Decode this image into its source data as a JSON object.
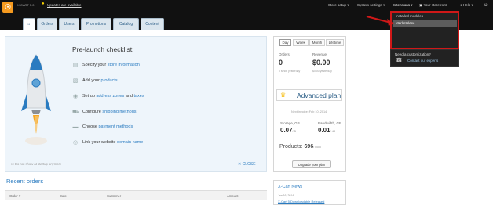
{
  "topbar": {
    "logo_letter": "☉",
    "powered": "X-CART 5.0",
    "updates": "Updates are available",
    "store_setup": "Store setup",
    "system_settings": "System settings",
    "extensions": "Extensions",
    "your_storefront": "Your storefront",
    "help": "Help"
  },
  "tabs": [
    "Orders",
    "Users",
    "Promotions",
    "Catalog",
    "Content"
  ],
  "checklist": {
    "title": "Pre-launch checklist:",
    "items": [
      {
        "pre": "Specify your ",
        "link": "store information",
        "post": ""
      },
      {
        "pre": "Add your ",
        "link": "products",
        "post": ""
      },
      {
        "pre": "Set up ",
        "link": "address zones",
        "mid": " and ",
        "link2": "taxes"
      },
      {
        "pre": "Configure ",
        "link": "shipping methods",
        "post": ""
      },
      {
        "pre": "Choose ",
        "link": "payment methods",
        "post": ""
      },
      {
        "pre": "Link your website ",
        "link": "domain name",
        "post": ""
      }
    ],
    "dont_show": "Do not show at startup anymore",
    "close": "CLOSE"
  },
  "recent": {
    "title": "Recent orders",
    "columns": [
      "Order #",
      "Date",
      "Customer",
      "Amount"
    ]
  },
  "periods": [
    "Day",
    "Week",
    "Month",
    "Lifetime"
  ],
  "stats": {
    "orders_label": "Orders",
    "orders_value": "0",
    "orders_sub": "0 since yesterday",
    "revenue_label": "Revenue",
    "revenue_value": "$0.00",
    "revenue_sub": "$0.00 yesterday"
  },
  "plan": {
    "title": "Advanced plan",
    "next_invoice": "Next invoice: Feb 10, 2014",
    "storage_label": "Storage, GB",
    "storage_value": "0.07",
    "storage_max": "/ 5",
    "bandwidth_label": "Bandwidth, GB",
    "bandwidth_value": "0.01",
    "bandwidth_max": "/ 40",
    "products_label": "Products:",
    "products_value": "696",
    "products_max": "/ 5000",
    "upgrade": "Upgrade your plan"
  },
  "news": {
    "title": "X-Cart News",
    "date": "Jan 16, 2014",
    "link": "X-Cart 5 Downloadable Released"
  },
  "dropdown": {
    "items": [
      "Installed modules",
      "Marketplace"
    ],
    "customization_title": "Need a customization?",
    "customization_link": "Contact our experts"
  },
  "colors": {
    "accent": "#2a7bc0",
    "highlight": "#d01818",
    "brand": "#f59a1f"
  }
}
